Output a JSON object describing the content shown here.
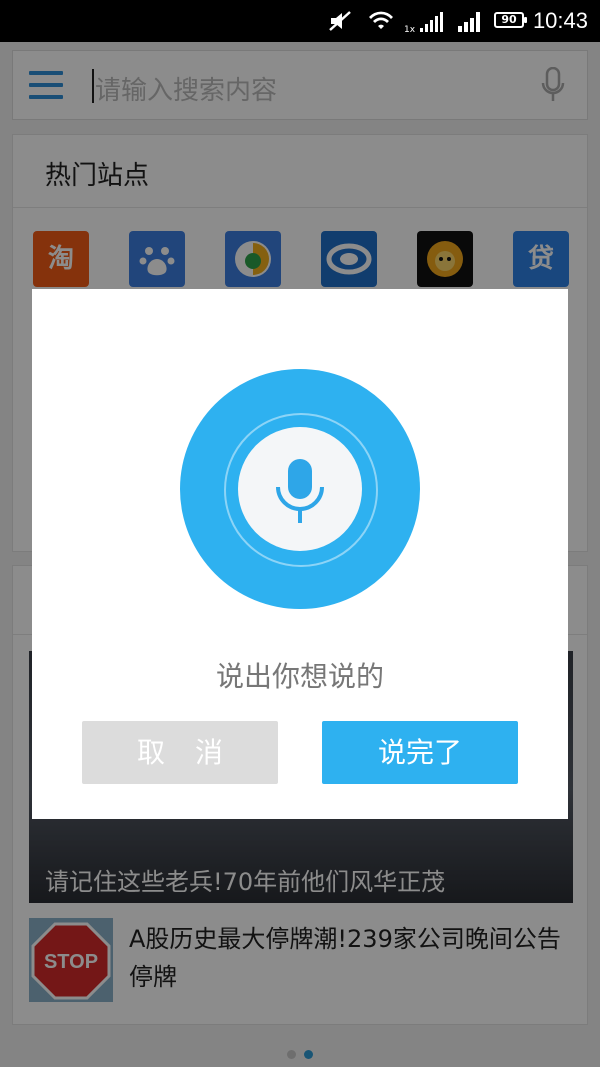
{
  "status_bar": {
    "time": "10:43",
    "battery": "90"
  },
  "search": {
    "placeholder": "请输入搜索内容"
  },
  "hot_sites": {
    "title": "热门站点",
    "sites": [
      {
        "glyph": "淘",
        "color": "#f25b16"
      },
      {
        "glyph": "",
        "color": "#3d7fe0"
      },
      {
        "glyph": "",
        "color": "#3d7fe0"
      },
      {
        "glyph": "",
        "color": "#1f6fc9"
      },
      {
        "glyph": "",
        "color": "#111111"
      },
      {
        "glyph": "贷",
        "color": "#2e82e6"
      }
    ]
  },
  "news": {
    "featured_caption": "请记住这些老兵!70年前他们风华正茂",
    "thumb_text": "STOP",
    "item_headline": "A股历史最大停牌潮!239家公司晚间公告停牌"
  },
  "voice_dialog": {
    "prompt": "说出你想说的",
    "cancel_label": "取消",
    "done_label": "说完了"
  },
  "colors": {
    "accent": "#2eb1f0",
    "menu": "#2f8fd8"
  }
}
